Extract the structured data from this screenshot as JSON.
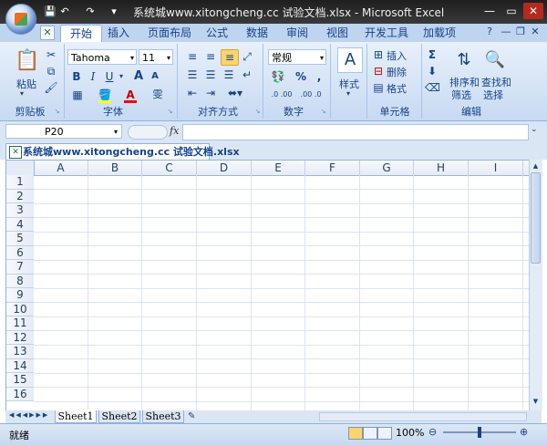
{
  "window": {
    "title": "系统城www.xitongcheng.cc 试验文档.xlsx - Microsoft Excel",
    "controls": [
      "—",
      "▭",
      "✕"
    ]
  },
  "qat": [
    "💾",
    "↶",
    "↷",
    "▾"
  ],
  "tabs": [
    "开始",
    "插入",
    "页面布局",
    "公式",
    "数据",
    "审阅",
    "视图",
    "开发工具",
    "加载项"
  ],
  "active_tab": "开始",
  "ribbon": {
    "clipboard": {
      "label": "剪贴板",
      "paste": "粘贴"
    },
    "font": {
      "label": "字体",
      "name": "Tahoma",
      "size": "11",
      "bold": "B",
      "italic": "I",
      "underline": "U",
      "grow": "A",
      "shrink": "A",
      "wen": "雯"
    },
    "alignment": {
      "label": "对齐方式"
    },
    "number": {
      "label": "数字",
      "format": "常规",
      "percent": "%",
      "comma": ",",
      "dec_inc": ".0 .00",
      "dec_dec": ".00 .0"
    },
    "styles": {
      "label": "样式",
      "button": "样式"
    },
    "cells": {
      "label": "单元格",
      "insert": "插入",
      "delete": "删除",
      "format": "格式"
    },
    "editing": {
      "label": "编辑",
      "sum": "Σ",
      "sort": "排序和",
      "sort2": "筛选",
      "find": "查找和",
      "find2": "选择"
    }
  },
  "formula_bar": {
    "name_box": "P20",
    "fx": "fx",
    "value": ""
  },
  "workbook": {
    "title": "系统城www.xitongcheng.cc 试验文档.xlsx"
  },
  "grid": {
    "columns": [
      "A",
      "B",
      "C",
      "D",
      "E",
      "F",
      "G",
      "H",
      "I"
    ],
    "rows": [
      "1",
      "2",
      "3",
      "4",
      "5",
      "6",
      "7",
      "8",
      "9",
      "10",
      "11",
      "12",
      "13",
      "14",
      "15",
      "16"
    ]
  },
  "sheets": [
    "Sheet1",
    "Sheet2",
    "Sheet3"
  ],
  "status": {
    "ready": "就绪",
    "zoom": "100%"
  },
  "colors": {
    "ribbon_bg": "#dbe6f4",
    "accent": "#15428b",
    "title_bg": "#2b2b2b"
  }
}
